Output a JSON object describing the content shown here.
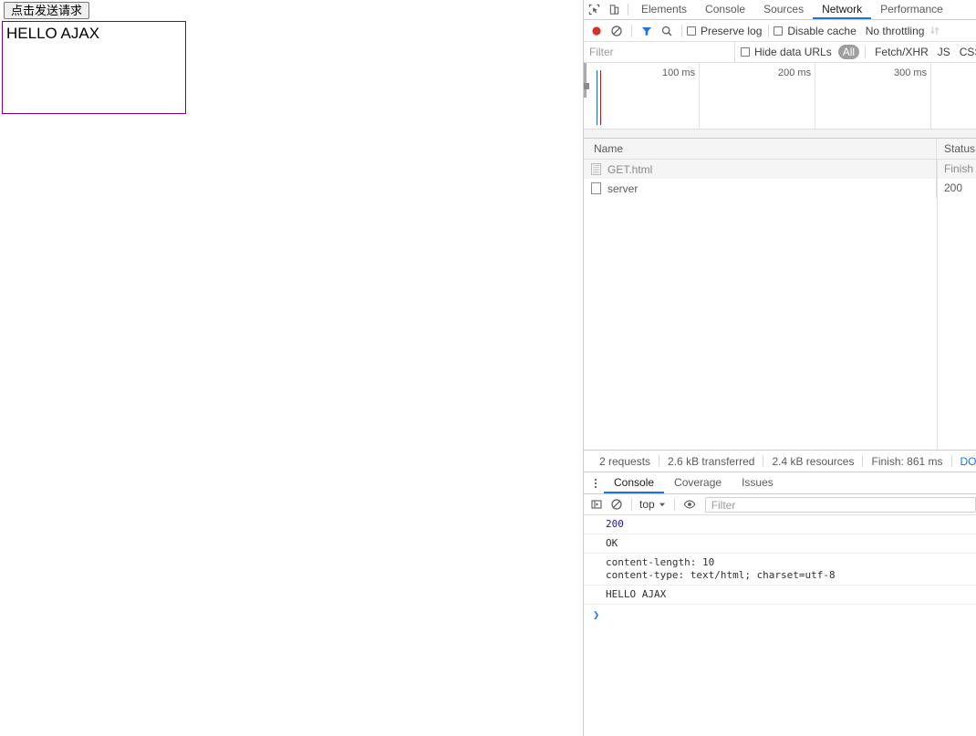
{
  "page": {
    "button_label": "点击发送请求",
    "result_text": "HELLO AJAX"
  },
  "devtools": {
    "tabs": [
      {
        "label": "Elements",
        "active": false
      },
      {
        "label": "Console",
        "active": false
      },
      {
        "label": "Sources",
        "active": false
      },
      {
        "label": "Network",
        "active": true
      },
      {
        "label": "Performance",
        "active": false
      }
    ],
    "network_toolbar": {
      "record_title": "record-button",
      "clear_title": "clear-button",
      "filter_title": "filter-button",
      "search_title": "search-button",
      "preserve_log_label": "Preserve log",
      "disable_cache_label": "Disable cache",
      "throttling_value": "No throttling"
    },
    "filter_row": {
      "filter_placeholder": "Filter",
      "hide_data_urls_label": "Hide data URLs",
      "types": [
        "All",
        "Fetch/XHR",
        "JS",
        "CSS"
      ],
      "selected_type": "All"
    },
    "overview": {
      "ticks": [
        "100 ms",
        "200 ms",
        "300 ms"
      ],
      "dom_content_loaded_color": "#1a6fc4",
      "load_event_color": "#a51b1b"
    },
    "requests_table": {
      "columns": [
        "Name",
        "Status"
      ],
      "rows": [
        {
          "name": "GET.html",
          "status": "Finish",
          "icon": "document-icon",
          "selected": true
        },
        {
          "name": "server",
          "status": "200",
          "icon": "blank-document-icon",
          "selected": false
        }
      ]
    },
    "network_status": {
      "requests": "2 requests",
      "transferred": "2.6 kB transferred",
      "resources": "2.4 kB resources",
      "finish": "Finish: 861 ms",
      "dom_content_loaded": "DOMC"
    },
    "drawer": {
      "tabs": [
        {
          "label": "Console",
          "active": true
        },
        {
          "label": "Coverage",
          "active": false
        },
        {
          "label": "Issues",
          "active": false
        }
      ],
      "toolbar": {
        "context": "top",
        "filter_placeholder": "Filter"
      },
      "console_lines": [
        {
          "text": "200",
          "kind": "number"
        },
        {
          "text": "OK",
          "kind": "text"
        },
        {
          "text": "content-length: 10\ncontent-type: text/html; charset=utf-8",
          "kind": "text"
        },
        {
          "text": "HELLO AJAX",
          "kind": "text"
        }
      ],
      "prompt": "❯"
    }
  },
  "colors": {
    "accent": "#1a73e8",
    "record_red": "#d93025",
    "filter_blue": "#1a73e8",
    "box_purple": "#800080"
  }
}
